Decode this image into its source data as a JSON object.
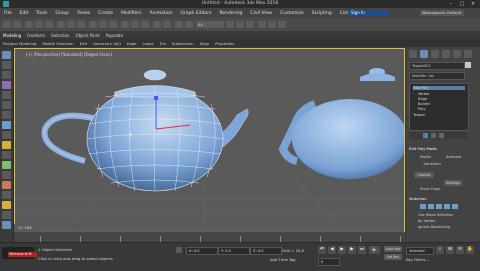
{
  "app": {
    "title": "Untitled - Autodesk 3ds Max 2018",
    "sign_in": "Sign In",
    "workspace": "Workspaces: Default"
  },
  "menu": [
    "File",
    "Edit",
    "Tools",
    "Group",
    "Views",
    "Create",
    "Modifiers",
    "Animation",
    "Graph Editors",
    "Rendering",
    "Civil View",
    "Customize",
    "Scripting",
    "Content"
  ],
  "toolbar": {
    "selection_filter": "All"
  },
  "ribbon": [
    "Modeling",
    "Freeform",
    "Selection",
    "Object Paint",
    "Populate"
  ],
  "subribbon": [
    "Polygon Modeling",
    "Modify Selection",
    "Edit",
    "Geometry (All)",
    "Edge",
    "Loops",
    "Tris",
    "Subdivision",
    "Align",
    "Properties"
  ],
  "viewport": {
    "label": "[+] [Perspective] [Standard] [Edged Faces]"
  },
  "command_panel": {
    "object_name": "Teapot001",
    "modifier_list": "Modifier List",
    "stack": [
      "Edit Poly",
      "Vertex",
      "Edge",
      "Border",
      "Poly",
      "Teapot"
    ],
    "rollout_mode": "Edit Poly Mode",
    "mode_label1": "Model",
    "mode_label2": "Animate",
    "transform": "Transform",
    "commit": "Commit",
    "settings": "Settings",
    "show_cage": "Show Cage",
    "selection": "Selection",
    "use_stack": "Use Stack Selection",
    "by_vertex": "By Vertex",
    "ignore_backfacing": "Ignore Backfacing"
  },
  "timeline": {
    "frame": "0 / 100"
  },
  "status": {
    "objects_selected": "1 Object Selected",
    "prompt": "Click or click-and-drag to select objects",
    "x": "X: 0.0",
    "y": "Y: 0.0",
    "z": "Z: 0.0",
    "grid": "Grid = 10.0",
    "add_time_tag": "Add Time Tag",
    "auto_key": "Auto Key",
    "set_key": "Set Key",
    "selected": "Selected",
    "key_filters": "Key Filters...",
    "frame_field": "0",
    "maxscript": "Welcome to M"
  },
  "colors": {
    "accent": "#1f4f86",
    "viewport_border": "#e0c040",
    "teapot": "#7fa6d8"
  }
}
